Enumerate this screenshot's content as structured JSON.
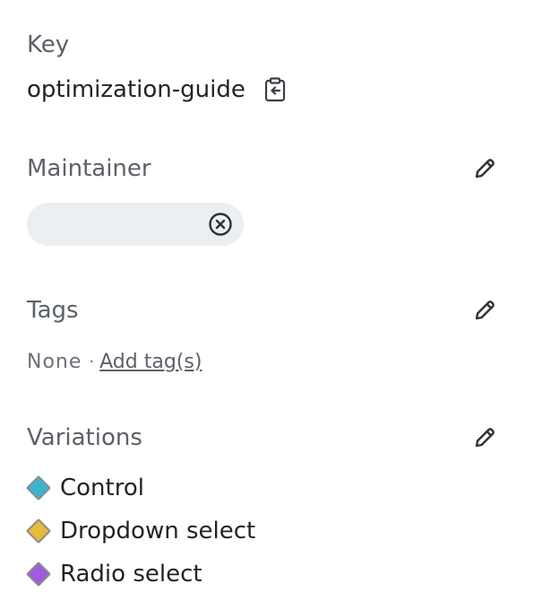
{
  "key": {
    "label": "Key",
    "value": "optimization-guide"
  },
  "maintainer": {
    "label": "Maintainer"
  },
  "tags": {
    "label": "Tags",
    "none_text": "None",
    "separator": "·",
    "add_link": "Add tag(s)"
  },
  "variations": {
    "label": "Variations",
    "items": [
      {
        "label": "Control",
        "color": "#3ab5d0"
      },
      {
        "label": "Dropdown select",
        "color": "#e8b93a"
      },
      {
        "label": "Radio select",
        "color": "#a25ae0"
      }
    ]
  },
  "icons": {
    "copy": "clipboard-copy-icon",
    "edit": "pencil-icon",
    "clear": "circle-x-icon"
  }
}
